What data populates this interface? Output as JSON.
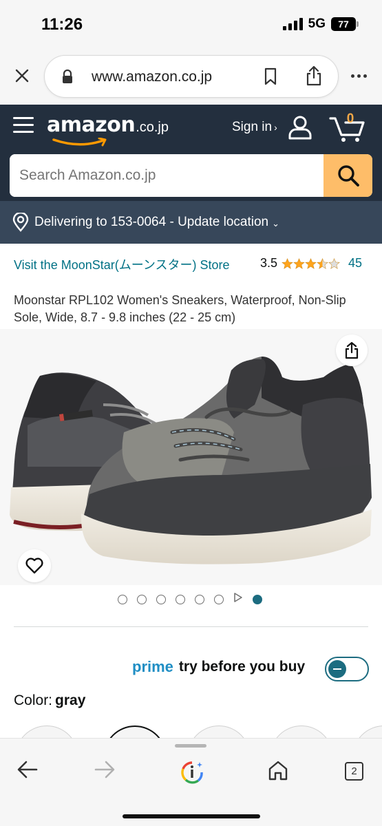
{
  "status_bar": {
    "time": "11:26",
    "network": "5G",
    "battery": "77"
  },
  "browser": {
    "url": "www.amazon.co.jp",
    "icons": [
      "close-icon",
      "lock-icon",
      "bookmark-icon",
      "share-icon",
      "more-icon"
    ]
  },
  "header": {
    "logo_text": "amazon",
    "logo_domain": ".co.jp",
    "sign_in": "Sign in",
    "sign_in_chevron": "›",
    "cart_count": "0",
    "search_placeholder": "Search Amazon.co.jp"
  },
  "delivery": {
    "text": "Delivering to 153-0064 - Update location",
    "chevron": "⌄"
  },
  "product": {
    "store_link": "Visit the MoonStar(ムーンスター) Store",
    "rating_value": "3.5",
    "rating_stars": 3.5,
    "rating_count": "45",
    "title": "Moonstar RPL102 Women's Sneakers, Waterproof, Non-Slip Sole, Wide, 8.7 - 9.8 inches (22 - 25 cm)"
  },
  "carousel": {
    "total_dots": 7,
    "has_video": true,
    "active_index": 7
  },
  "prime": {
    "word": "prime",
    "tagline": "try before you buy",
    "toggle_on": true
  },
  "color": {
    "label": "Color:",
    "value": "gray"
  },
  "colors": {
    "accent": "#1c6c80",
    "link": "#007185",
    "header_bg": "#232f3e",
    "delivery_bg": "#37475a",
    "search_btn": "#febd69",
    "star": "#ffa41c"
  },
  "toolbar": {
    "tabs_count": "2"
  }
}
